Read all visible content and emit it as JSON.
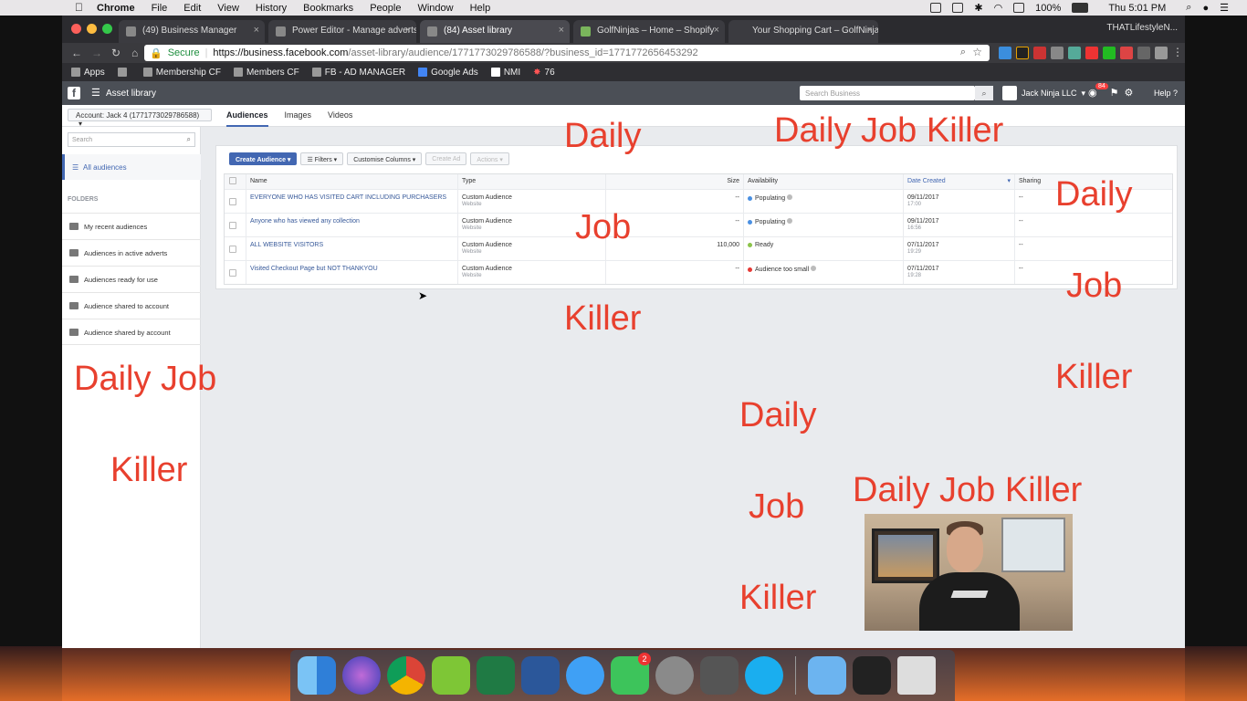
{
  "menubar": {
    "app": "Chrome",
    "menus": [
      "File",
      "Edit",
      "View",
      "History",
      "Bookmarks",
      "People",
      "Window",
      "Help"
    ],
    "battery": "100%",
    "clock": "Thu 5:01 PM"
  },
  "browser": {
    "tabs": [
      {
        "title": "(49) Business Manager"
      },
      {
        "title": "Power Editor - Manage adverts"
      },
      {
        "title": "(84) Asset library"
      },
      {
        "title": "GolfNinjas – Home – Shopify"
      },
      {
        "title": "Your Shopping Cart – GolfNinjas"
      }
    ],
    "profile": "THATLifestyleN...",
    "secure_label": "Secure",
    "url_host": "https://business.facebook.com",
    "url_path": "/asset-library/audience/1771773029786588/?business_id=1771772656453292",
    "bookmarks": [
      "Apps",
      "Membership CF",
      "Members CF",
      "FB - AD MANAGER",
      "Google Ads",
      "NMI",
      "76"
    ]
  },
  "fb": {
    "page_title": "Asset library",
    "search_placeholder": "Search Business",
    "account_name": "Jack Ninja LLC",
    "notif_count": "84",
    "help": "Help",
    "account_select": "Account: Jack 4 (1771773029786588)",
    "tabs": [
      "Audiences",
      "Images",
      "Videos"
    ],
    "sidebar": {
      "search_placeholder": "Search",
      "all_audiences": "All audiences",
      "folders_label": "FOLDERS",
      "folders": [
        "My recent audiences",
        "Audiences in active adverts",
        "Audiences ready for use",
        "Audience shared to account",
        "Audience shared by account"
      ]
    },
    "toolbar": {
      "create": "Create Audience ▾",
      "filters": "☰ Filters ▾",
      "columns": "Customise Columns ▾",
      "create_ad": "Create Ad",
      "actions": "Actions ▾"
    },
    "columns": [
      "Name",
      "Type",
      "Size",
      "Availability",
      "Date Created",
      "Sharing"
    ],
    "rows": [
      {
        "name": "EVERYONE WHO HAS VISITED CART INCLUDING PURCHASERS",
        "type": "Custom Audience",
        "subtype": "Website",
        "size": "--",
        "availability": "Populating",
        "date": "09/11/2017",
        "time": "17:00",
        "sharing": "--"
      },
      {
        "name": "Anyone who has viewed any collection",
        "type": "Custom Audience",
        "subtype": "Website",
        "size": "--",
        "availability": "Populating",
        "date": "09/11/2017",
        "time": "16:56",
        "sharing": "--"
      },
      {
        "name": "ALL WEBSITE VISITORS",
        "type": "Custom Audience",
        "subtype": "Website",
        "size": "110,000",
        "availability": "Ready",
        "date": "07/11/2017",
        "time": "19:29",
        "sharing": "--"
      },
      {
        "name": "Visited Checkout Page but NOT THANKYOU",
        "type": "Custom Audience",
        "subtype": "Website",
        "size": "--",
        "availability": "Audience too small",
        "date": "07/11/2017",
        "time": "19:28",
        "sharing": "--"
      }
    ],
    "status_colors": {
      "populating": "#4a90e2",
      "ready": "#8bc34a",
      "too_small": "#e53935"
    }
  },
  "watermark": {
    "words": [
      "Daily",
      "Daily Job Killer",
      "Daily",
      "Job",
      "Job",
      "Killer",
      "Killer",
      "Daily Job",
      "Daily",
      "Killer",
      "Daily Job Killer",
      "Job",
      "Killer"
    ],
    "color": "#e8402e"
  },
  "dock": {
    "facetime_badge": "2"
  }
}
